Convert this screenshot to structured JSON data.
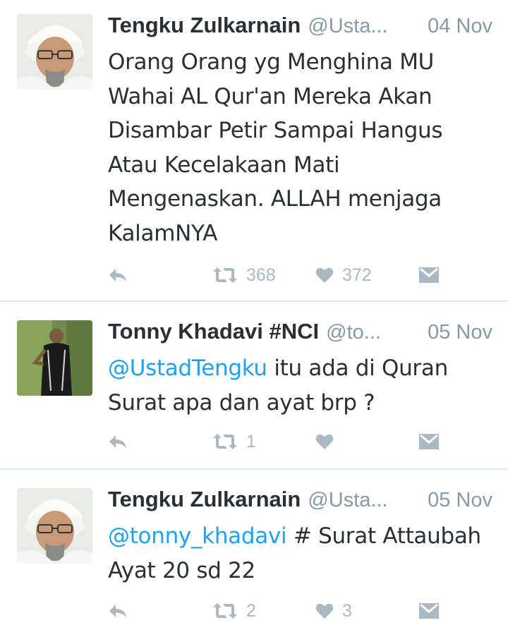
{
  "colors": {
    "name": "#292f33",
    "meta": "#8899a6",
    "mention": "#1da1f2",
    "action_icon": "#aab8c2",
    "divider": "#e1e8ed"
  },
  "tweets": [
    {
      "name": "Tengku Zulkarnain",
      "handle": "@Usta...",
      "date": "04 Nov",
      "mention": "",
      "text": "Orang Orang yg Menghina MU Wahai AL Qur'an Mereka Akan Disambar Petir Sampai Hangus Atau Kecelakaan Mati Mengenaskan. ALLAH menjaga KalamNYA",
      "retweets": "368",
      "likes": "372",
      "avatar_icon": "profile-photo"
    },
    {
      "name": "Tonny Khadavi #NCI",
      "handle": "@to...",
      "date": "05 Nov",
      "mention": "@UstadTengku",
      "text": " itu ada di Quran Surat apa dan ayat brp ?",
      "retweets": "1",
      "likes": "",
      "avatar_icon": "profile-photo"
    },
    {
      "name": "Tengku Zulkarnain",
      "handle": "@Usta...",
      "date": "05 Nov",
      "mention": "@tonny_khadavi",
      "text": " # Surat Attaubah Ayat 20 sd 22",
      "retweets": "2",
      "likes": "3",
      "avatar_icon": "profile-photo"
    }
  ],
  "action_icons": [
    "reply-icon",
    "retweet-icon",
    "like-icon",
    "direct-message-icon"
  ]
}
